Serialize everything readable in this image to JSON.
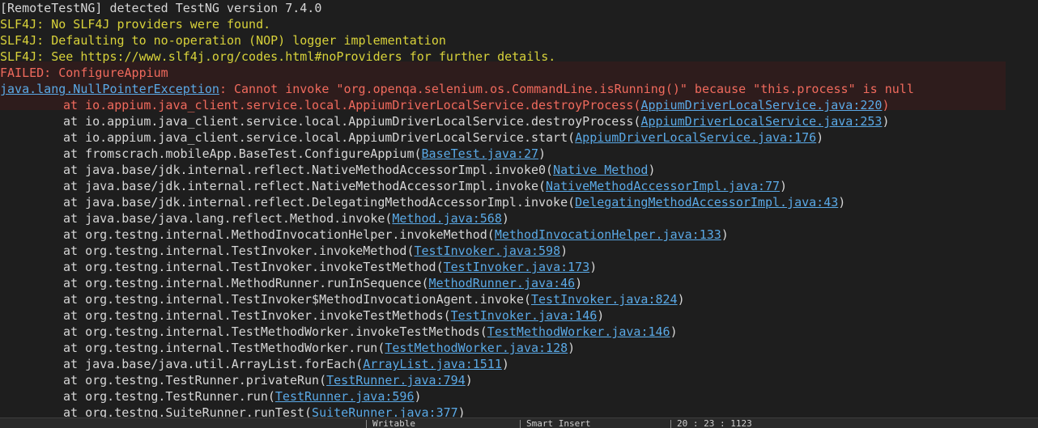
{
  "console": {
    "header_line": "[RemoteTestNG] detected TestNG version 7.4.0",
    "slf4j_lines": [
      "SLF4J: No SLF4J providers were found.",
      "SLF4J: Defaulting to no-operation (NOP) logger implementation",
      "SLF4J: See https://www.slf4j.org/codes.html#noProviders for further details."
    ],
    "failed_line": "FAILED: ConfigureAppium",
    "exception": {
      "class_link": "java.lang.NullPointerException",
      "message": ": Cannot invoke \"org.openqa.selenium.os.CommandLine.isRunning()\" because \"this.process\" is null"
    },
    "stack": [
      {
        "method": "at io.appium.java_client.service.local.AppiumDriverLocalService.destroyProcess(",
        "link": "AppiumDriverLocalService.java:220",
        "close": ")"
      },
      {
        "method": "at io.appium.java_client.service.local.AppiumDriverLocalService.destroyProcess(",
        "link": "AppiumDriverLocalService.java:253",
        "close": ")"
      },
      {
        "method": "at io.appium.java_client.service.local.AppiumDriverLocalService.start(",
        "link": "AppiumDriverLocalService.java:176",
        "close": ")"
      },
      {
        "method": "at fromscrach.mobileApp.BaseTest.ConfigureAppium(",
        "link": "BaseTest.java:27",
        "close": ")"
      },
      {
        "method": "at java.base/jdk.internal.reflect.NativeMethodAccessorImpl.invoke0(",
        "link": "Native Method",
        "close": ")"
      },
      {
        "method": "at java.base/jdk.internal.reflect.NativeMethodAccessorImpl.invoke(",
        "link": "NativeMethodAccessorImpl.java:77",
        "close": ")"
      },
      {
        "method": "at java.base/jdk.internal.reflect.DelegatingMethodAccessorImpl.invoke(",
        "link": "DelegatingMethodAccessorImpl.java:43",
        "close": ")"
      },
      {
        "method": "at java.base/java.lang.reflect.Method.invoke(",
        "link": "Method.java:568",
        "close": ")"
      },
      {
        "method": "at org.testng.internal.MethodInvocationHelper.invokeMethod(",
        "link": "MethodInvocationHelper.java:133",
        "close": ")"
      },
      {
        "method": "at org.testng.internal.TestInvoker.invokeMethod(",
        "link": "TestInvoker.java:598",
        "close": ")"
      },
      {
        "method": "at org.testng.internal.TestInvoker.invokeTestMethod(",
        "link": "TestInvoker.java:173",
        "close": ")"
      },
      {
        "method": "at org.testng.internal.MethodRunner.runInSequence(",
        "link": "MethodRunner.java:46",
        "close": ")"
      },
      {
        "method": "at org.testng.internal.TestInvoker$MethodInvocationAgent.invoke(",
        "link": "TestInvoker.java:824",
        "close": ")"
      },
      {
        "method": "at org.testng.internal.TestInvoker.invokeTestMethods(",
        "link": "TestInvoker.java:146",
        "close": ")"
      },
      {
        "method": "at org.testng.internal.TestMethodWorker.invokeTestMethods(",
        "link": "TestMethodWorker.java:146",
        "close": ")"
      },
      {
        "method": "at org.testng.internal.TestMethodWorker.run(",
        "link": "TestMethodWorker.java:128",
        "close": ")"
      },
      {
        "method": "at java.base/java.util.ArrayList.forEach(",
        "link": "ArrayList.java:1511",
        "close": ")"
      },
      {
        "method": "at org.testng.TestRunner.privateRun(",
        "link": "TestRunner.java:794",
        "close": ")"
      },
      {
        "method": "at org.testng.TestRunner.run(",
        "link": "TestRunner.java:596",
        "close": ")"
      },
      {
        "method": "at org.testng.SuiteRunner.runTest(",
        "link": "SuiteRunner.java:377",
        "close": ")"
      }
    ]
  },
  "status_bar": {
    "item_1": "Writable",
    "item_2": "Smart Insert",
    "item_3": "20 : 23 : 1123"
  },
  "colors": {
    "background": "#1e1e1e",
    "highlight": "#2e1c1c",
    "yellow_text": "#d8d23a",
    "red_text": "#f06a5d",
    "link": "#5aa9e6"
  }
}
